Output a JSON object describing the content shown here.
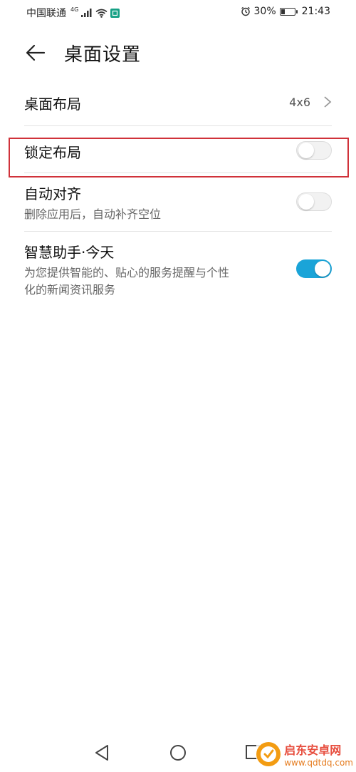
{
  "status_bar": {
    "carrier": "中国联通",
    "network": "4G",
    "battery": "30%",
    "battery_level": 0.3,
    "time": "21:43"
  },
  "header": {
    "title": "桌面设置"
  },
  "settings": [
    {
      "label": "桌面布局",
      "value": "4x6"
    },
    {
      "label": "锁定布局",
      "subtitle": "",
      "toggle": false
    },
    {
      "label": "自动对齐",
      "subtitle": "删除应用后，自动补齐空位",
      "toggle": false
    },
    {
      "label": "智慧助手·今天",
      "subtitle_line1": "为您提供智能的、贴心的服务提醒与个性",
      "subtitle_line2": "化的新闻资讯服务",
      "toggle": true
    }
  ],
  "colors": {
    "toggle_on": "#1aa4d8",
    "highlight": "#d0323a"
  },
  "watermark": {
    "title": "启东安卓网",
    "url": "www.qdtdq.com"
  }
}
